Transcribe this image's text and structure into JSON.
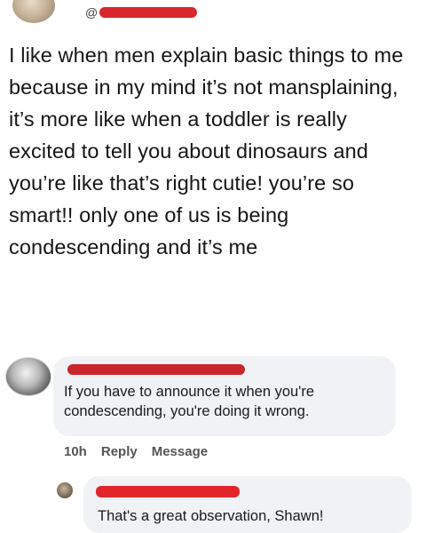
{
  "post": {
    "handle_prefix": "@",
    "text": "I like when men explain basic things to me because in my mind it’s not mansplaining, it’s more like when a toddler is really excited to tell you about dinosaurs and you’re like that’s right cutie! you’re so smart!! only one of us is being condescending and it’s me"
  },
  "comments": [
    {
      "text": "If you have to announce it when you're condescending, you're doing it wrong.",
      "time": "10h",
      "reply_label": "Reply",
      "message_label": "Message"
    },
    {
      "text": "That's a great observation, Shawn!"
    }
  ],
  "colors": {
    "redaction": "#d9262c",
    "comment_bubble": "#f0f2f5",
    "action_text": "#555555"
  }
}
